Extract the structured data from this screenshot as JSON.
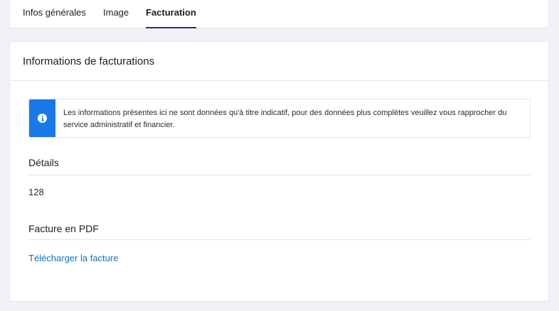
{
  "tabs": [
    {
      "label": "Infos générales",
      "active": false
    },
    {
      "label": "Image",
      "active": false
    },
    {
      "label": "Facturation",
      "active": true
    }
  ],
  "panel": {
    "title": "Informations de facturations"
  },
  "notice": {
    "icon": "info-icon",
    "text": "Les informations présentes ici ne sont données qu'à titre indicatif, pour des données plus complètes veuillez vous rapprocher du service administratif et financier.",
    "accent_color": "#1a79e8"
  },
  "details": {
    "title": "Détails",
    "value": "128"
  },
  "invoice": {
    "title": "Facture en PDF",
    "link_label": "Télécharger la facture",
    "link_color": "#1a6fb8"
  }
}
